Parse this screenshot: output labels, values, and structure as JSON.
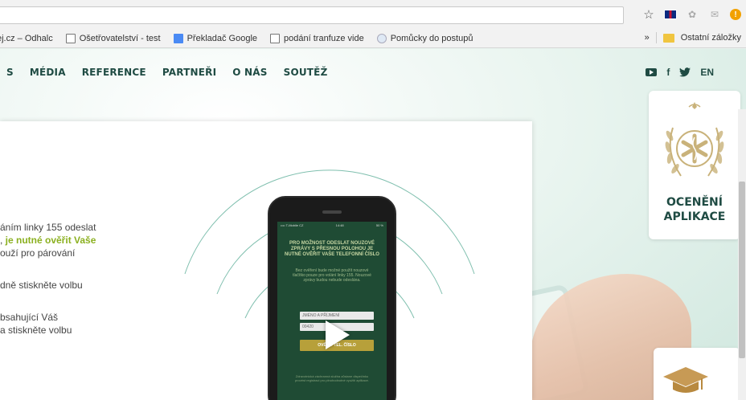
{
  "browser": {
    "bookmarks": [
      {
        "label": "ej.cz – Odhalc",
        "icon": "none"
      },
      {
        "label": "Ošetřovatelství - test",
        "icon": "page-icon"
      },
      {
        "label": "Překladač Google",
        "icon": "google-translate-icon"
      },
      {
        "label": "podání tranfuze vide",
        "icon": "page-icon"
      },
      {
        "label": "Pomůcky do postupů",
        "icon": "globe-icon"
      }
    ],
    "more_label": "»",
    "other_bookmarks_label": "Ostatní záložky"
  },
  "nav": {
    "items": [
      "S",
      "MÉDIA",
      "REFERENCE",
      "PARTNEŘI",
      "O NÁS",
      "SOUTĚŽ"
    ],
    "lang_label": "EN",
    "facebook_label": "f"
  },
  "modal": {
    "line1": "áním linky 155 odeslat",
    "line2_prefix": ", ",
    "line2_highlight": "je nutné ověřit Vaše",
    "line3": "ouží pro párování",
    "line4": "dně stiskněte volbu",
    "line5": "bsahující Váš",
    "line6": "a stiskněte volbu"
  },
  "phone": {
    "status_left": "•••• T-Mobile CZ",
    "status_time": "14:48",
    "status_right": "50 %",
    "title": "PRO MOŽNOST ODESLAT NOUZOVÉ ZPRÁVY S PŘESNOU POLOHOU JE NUTNÉ OVĚŘIT VAŠE TELEFONNÍ ČÍSLO",
    "subtitle": "Bez ověření bude možné použít nouzové tlačítko pouze pro volání linky 155. Nouzové zprávy budou nebude odeslána.",
    "name_placeholder": "JMÉNO A PŘÍJMENÍ",
    "phone_prefix": "00420",
    "verify_button": "OVĚŘIT TEL. ČÍSLO",
    "footer": "Zdravotnická záchranná služba zůstane dispečinku provést registraci pro plnohodnotné využití aplikace."
  },
  "side": {
    "award_label_1": "OCENĚNÍ",
    "award_label_2": "APLIKACE"
  },
  "colors": {
    "nav_text": "#1f4b43",
    "highlight_green": "#8bb020",
    "arc": "#7fbfae"
  }
}
